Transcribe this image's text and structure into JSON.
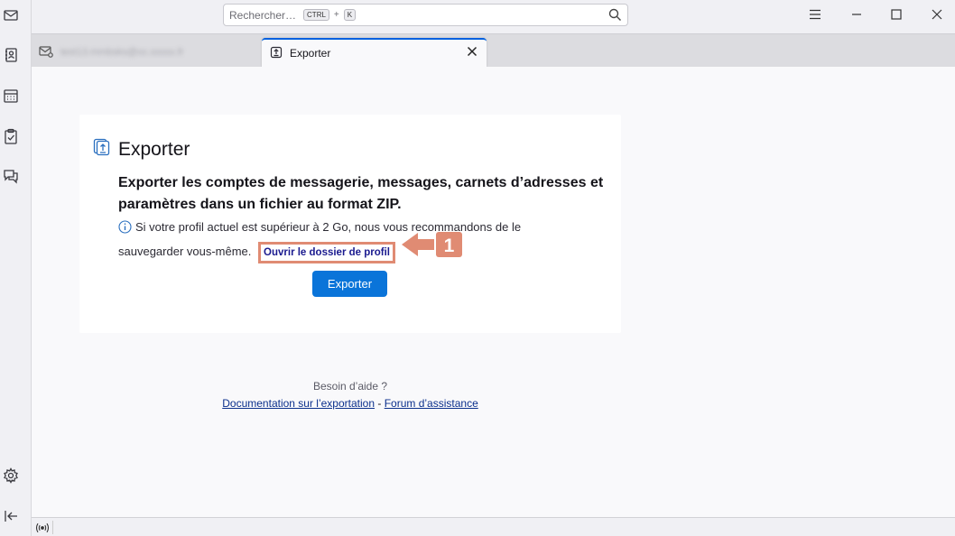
{
  "search": {
    "placeholder": "Rechercher…",
    "key1": "CTRL",
    "plus": "+",
    "key2": "K"
  },
  "tabs": [
    {
      "label": "test13.mmbsks@xx.xxxxx.fr",
      "icon": "mail-account-icon",
      "active": false
    },
    {
      "label": "Exporter",
      "icon": "export-icon",
      "active": true
    }
  ],
  "card": {
    "title": "Exporter",
    "heading": "Exporter les comptes de messagerie, messages, carnets d’adresses et paramètres dans un fichier au format ZIP.",
    "note": "Si votre profil actuel est supérieur à 2 Go, nous vous recommandons de le sauvegarder vous-même.",
    "profile_link": "Ouvrir le dossier de profil",
    "export_button": "Exporter"
  },
  "annotation": {
    "number": "1"
  },
  "help": {
    "question": "Besoin d’aide ?",
    "doc_link": "Documentation sur l’exportation",
    "separator": "-",
    "forum_link": "Forum d’assistance"
  },
  "colors": {
    "accent": "#0a74d9",
    "annotation": "#e08b73",
    "link": "#1a1a8f"
  }
}
